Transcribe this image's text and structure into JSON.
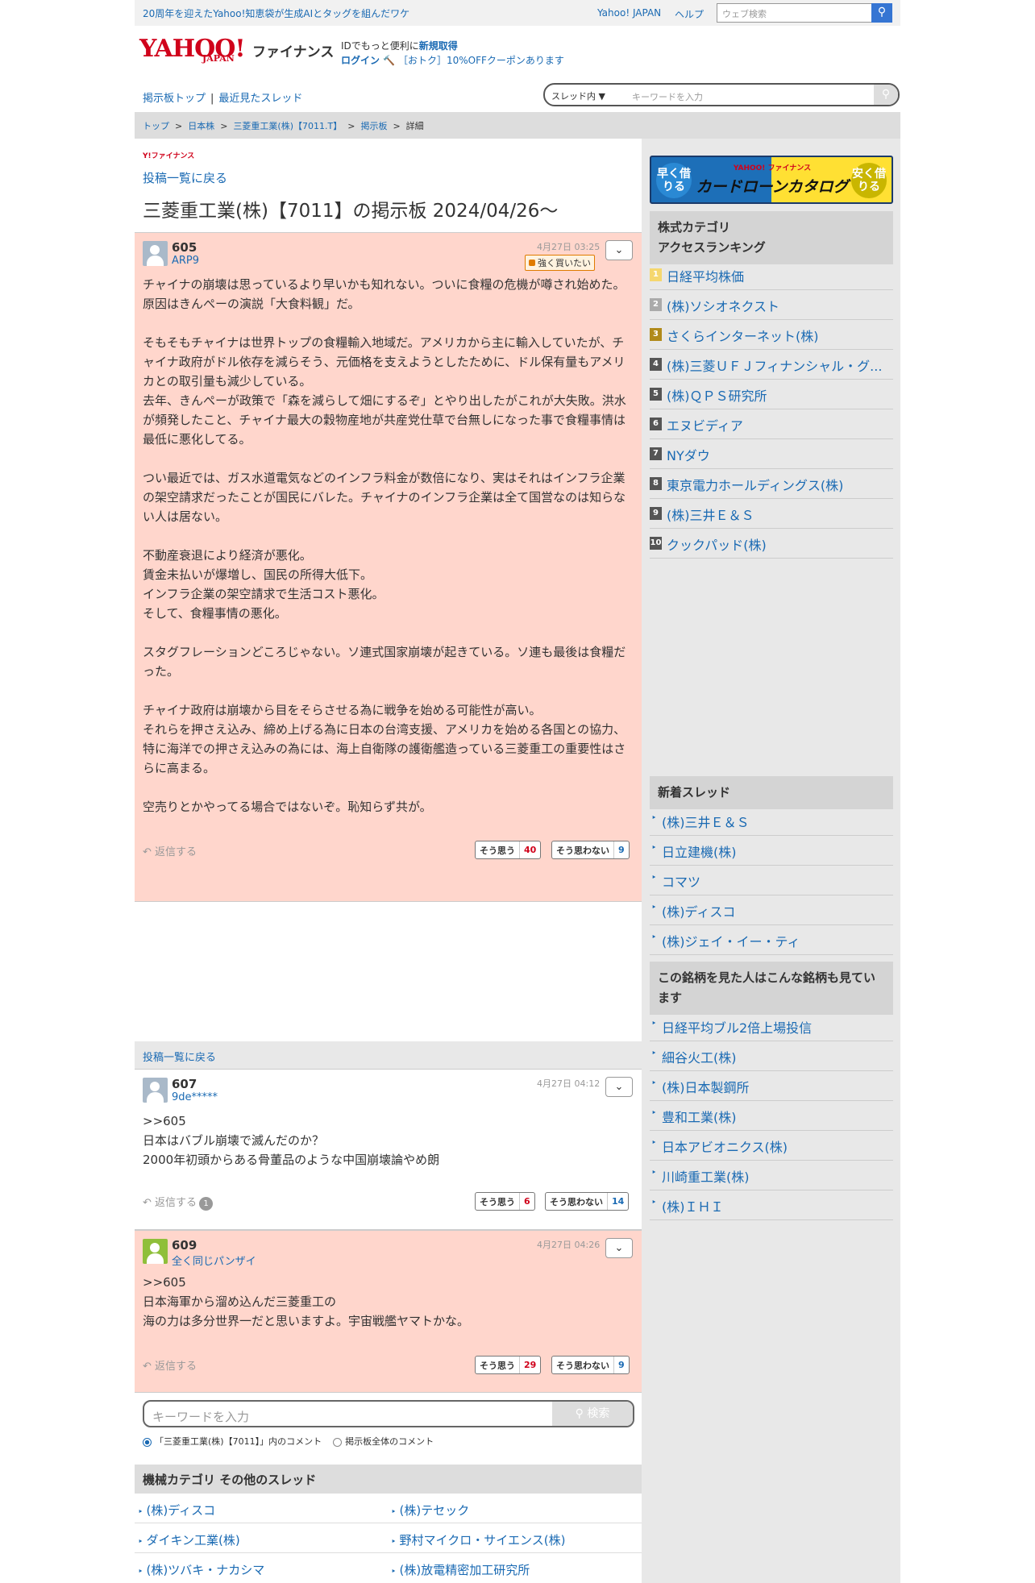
{
  "topbar": {
    "ad_text": "20周年を迎えたYahoo!知恵袋が生成AIとタッグを組んだワケ",
    "yahoo_japan": "Yahoo! JAPAN",
    "help": "ヘルプ",
    "web_search_placeholder": "ウェブ検索"
  },
  "header": {
    "logo": "YAHOO!",
    "logo_sub": "JAPAN",
    "service": "ファイナンス",
    "id_prefix": "IDでもっと便利に",
    "id_link": "新規取得",
    "login": "ログイン",
    "coupon": "［おトク］10%OFFクーポンあります"
  },
  "nav": {
    "board_top": "掲示板トップ",
    "recent": "最近見たスレッド",
    "search_scope": "スレッド内",
    "search_placeholder": "キーワードを入力"
  },
  "breadcrumb": [
    "トップ",
    "日本株",
    "三菱重工業(株)【7011.T】",
    "掲示板",
    "詳細"
  ],
  "main": {
    "brand_small": "Y!ファイナンス",
    "back_label": "投稿一覧に戻る",
    "page_title": "三菱重工業(株)【7011】の掲示板 2024/04/26〜",
    "reply_label": "返信する",
    "agree_label": "そう思う",
    "disagree_label": "そう思わない",
    "posts": [
      {
        "number": "605",
        "user": "ARP9",
        "date": "4月27日 03:25",
        "badge": "強く買いたい",
        "body": "チャイナの崩壊は思っているより早いかも知れない。ついに食糧の危機が噂され始めた。原因はきんぺーの演説「大食料観」だ。\n\nそもそもチャイナは世界トップの食糧輸入地域だ。アメリカから主に輸入していたが、チャイナ政府がドル依存を減らそう、元価格を支えようとしたために、ドル保有量もアメリカとの取引量も減少している。\n去年、きんぺーが政策で「森を減らして畑にするぞ」とやり出したがこれが大失敗。洪水が頻発したこと、チャイナ最大の穀物産地が共産党仕草で台無しになった事で食糧事情は最低に悪化してる。\n\nつい最近では、ガス水道電気などのインフラ料金が数倍になり、実はそれはインフラ企業の架空請求だったことが国民にバレた。チャイナのインフラ企業は全て国営なのは知らない人は居ない。\n\n不動産衰退により経済が悪化。\n賃金未払いが爆増し、国民の所得大低下。\nインフラ企業の架空請求で生活コスト悪化。\nそして、食糧事情の悪化。\n\nスタグフレーションどころじゃない。ソ連式国家崩壊が起きている。ソ連も最後は食糧だった。\n\nチャイナ政府は崩壊から目をそらさせる為に戦争を始める可能性が高い。\nそれらを押さえ込み、締め上げる為に日本の台湾支援、アメリカを始める各国との協力、特に海洋での押さえ込みの為には、海上自衛隊の護衛艦造っている三菱重工の重要性はさらに高まる。\n\n空売りとかやってる場合ではないぞ。恥知らず共が。",
        "agree": "40",
        "disagree": "9"
      },
      {
        "number": "607",
        "user": "9de*****",
        "date": "4月27日 04:12",
        "body": ">>605\n日本はバブル崩壊で滅んだのか？\n2000年初頭からある骨董品のような中国崩壊論やめ朗",
        "reply_count": "1",
        "agree": "6",
        "disagree": "14"
      },
      {
        "number": "609",
        "user": "全く同じパンザイ",
        "date": "4月27日 04:26",
        "body": ">>605\n日本海軍から溜め込んだ三菱重工の\n海の力は多分世界一だと思いますよ。宇宙戦艦ヤマトかな。",
        "agree": "29",
        "disagree": "9"
      }
    ],
    "bottom_search": {
      "placeholder": "キーワードを入力",
      "button": "検索",
      "radio_thread": "「三菱重工業(株)【7011】」内のコメント",
      "radio_all": "掲示板全体のコメント"
    },
    "other_threads": {
      "heading": "機械カテゴリ その他のスレッド",
      "items": [
        "(株)ディスコ",
        "(株)テセック",
        "ダイキン工業(株)",
        "野村マイクロ・サイエンス(株)",
        "(株)ツバキ・ナカシマ",
        "(株)放電精密加工研究所"
      ]
    }
  },
  "side": {
    "banner": {
      "left": "早く借りる",
      "right": "安く借りる",
      "brand": "YAHOO! ファイナンス",
      "title": "カードローンカタログ"
    },
    "ranking_heading_1": "株式カテゴリ",
    "ranking_heading_2": "アクセスランキング",
    "ranking": [
      {
        "no": "1",
        "name": "日経平均株価"
      },
      {
        "no": "2",
        "name": "(株)ソシオネクスト"
      },
      {
        "no": "3",
        "name": "さくらインターネット(株)"
      },
      {
        "no": "4",
        "name": "(株)三菱ＵＦＪフィナンシャル・グ..."
      },
      {
        "no": "5",
        "name": "(株)ＱＰＳ研究所"
      },
      {
        "no": "6",
        "name": "エヌビディア"
      },
      {
        "no": "7",
        "name": "NYダウ"
      },
      {
        "no": "8",
        "name": "東京電力ホールディングス(株)"
      },
      {
        "no": "9",
        "name": "(株)三井Ｅ＆Ｓ"
      },
      {
        "no": "10",
        "name": "クックパッド(株)"
      }
    ],
    "new_threads_heading": "新着スレッド",
    "new_threads": [
      "(株)三井Ｅ＆Ｓ",
      "日立建機(株)",
      "コマツ",
      "(株)ディスコ",
      "(株)ジェイ・イー・ティ"
    ],
    "related_heading": "この銘柄を見た人はこんな銘柄も見ています",
    "related": [
      "日経平均ブル2倍上場投信",
      "細谷火工(株)",
      "(株)日本製鋼所",
      "豊和工業(株)",
      "日本アビオニクス(株)",
      "川崎重工業(株)",
      "(株)ＩＨＩ"
    ]
  }
}
